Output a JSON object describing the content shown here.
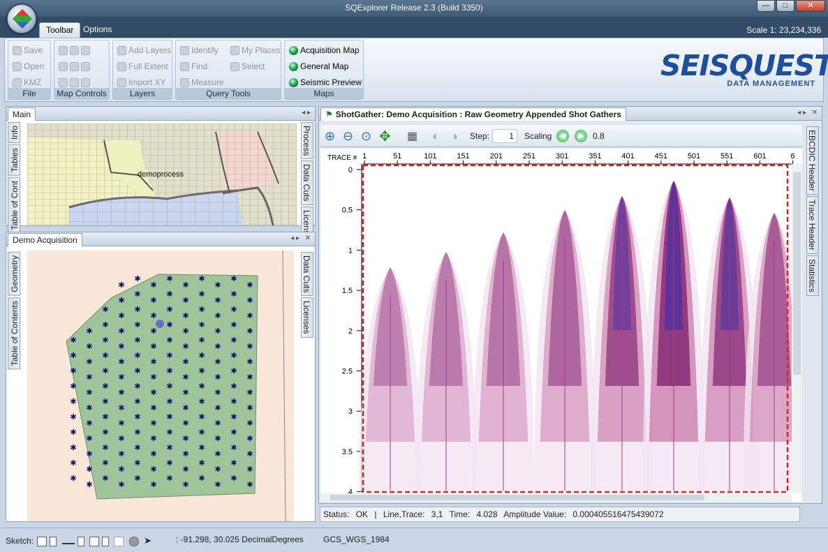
{
  "window": {
    "title": "SQExplorer Release 2.3 (Build 3350)"
  },
  "menu": {
    "tabs": [
      "Toolbar",
      "Options"
    ],
    "scale": "Scale 1: 23,234,336"
  },
  "ribbon": {
    "file": {
      "label": "File",
      "items": [
        "Save",
        "Open",
        "KMZ"
      ]
    },
    "map_controls": {
      "label": "Map Controls"
    },
    "layers": {
      "label": "Layers",
      "items": [
        "Add Layers",
        "Full Extent",
        "Import XY"
      ]
    },
    "query": {
      "label": "Query Tools",
      "items": [
        "Identify",
        "My Places",
        "Find",
        "Select",
        "Measure"
      ]
    },
    "maps": {
      "label": "Maps",
      "items": [
        "Acquisition Map",
        "General Map",
        "Seismic Preview"
      ]
    }
  },
  "logo": {
    "name": "SEISQUEST",
    "sub": "DATA MANAGEMENT"
  },
  "main_panel": {
    "title": "Main",
    "left_tabs": [
      "Info",
      "Tables",
      "Table of Cont"
    ],
    "right_tabs": [
      "Process",
      "Data Cuts",
      "Licens"
    ],
    "map_label": "demoprocess"
  },
  "demo_panel": {
    "title": "Demo Acquisition",
    "left_tabs": [
      "Geometry",
      "Table of Contents"
    ],
    "right_tabs": [
      "Data Cuts",
      "Licenses"
    ]
  },
  "shot_panel": {
    "title": "ShotGather: Demo Acquisition : Raw Geometry Appended Shot Gathers",
    "step_label": "Step:",
    "step_value": "1",
    "scaling_label": "Scaling",
    "scaling_value": "0.8",
    "right_tabs": [
      "EBCDIC Header",
      "Trace Header",
      "Statistics"
    ],
    "trace_label": "TRACE #",
    "trace_ticks": [
      "1",
      "51",
      "101",
      "151",
      "201",
      "251",
      "301",
      "351",
      "401",
      "451",
      "501",
      "551",
      "601",
      "6"
    ],
    "time_ticks": [
      "0",
      "0.5",
      "1",
      "1.5",
      "2",
      "2.5",
      "3",
      "3.5",
      "4"
    ]
  },
  "status": {
    "status_label": "Status:",
    "status_value": "OK",
    "sep": "|",
    "lt_label": "Line,Trace:",
    "lt_value": "3,1",
    "time_label": "Time:",
    "time_value": "4.028",
    "amp_label": "Amplitude Value:",
    "amp_value": "0.000405516475439072"
  },
  "bottom": {
    "sketch": "Sketch:",
    "coords": ": -91.298, 30.025 DecimalDegrees",
    "crs": "GCS_WGS_1984"
  }
}
